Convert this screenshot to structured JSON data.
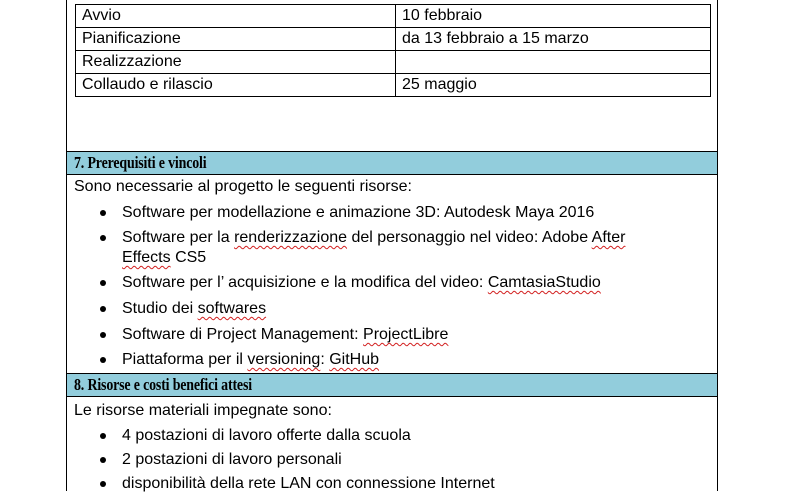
{
  "phases": [
    {
      "name": "Avvio",
      "date": "10 febbraio"
    },
    {
      "name": "Pianificazione",
      "date": "da 13 febbraio a 15 marzo"
    },
    {
      "name": "Realizzazione",
      "date": ""
    },
    {
      "name": "Collaudo e rilascio",
      "date": "25 maggio"
    }
  ],
  "section7": {
    "title": "7. Prerequisiti e vincoli",
    "intro": "Sono necessarie al progetto le seguenti risorse:",
    "items": [
      {
        "a": "Software per modellazione e animazione 3D: Autodesk Maya 2016"
      },
      {
        "a": "Software per la ",
        "b": "renderizzazione",
        "c": " del personaggio nel video: Adobe ",
        "d": "After",
        "e": "Effects",
        "f": " CS5"
      },
      {
        "a": "Software per l’ acquisizione e la modifica del video: ",
        "b": "CamtasiaStudio"
      },
      {
        "a": "Studio dei ",
        "b": "softwares"
      },
      {
        "a": "Software di Project Management: ",
        "b": "ProjectLibre"
      },
      {
        "a": "Piattaforma per il ",
        "b": "versioning",
        "c": ": ",
        "d": "GitHub"
      }
    ]
  },
  "section8": {
    "title": "8. Risorse e costi benefici attesi",
    "intro": "Le risorse materiali impegnate sono:",
    "items": [
      "4 postazioni di lavoro  offerte dalla scuola",
      "2 postazioni di lavoro personali",
      "disponibilità della rete LAN con connessione Internet"
    ]
  },
  "colors": {
    "header_bg": "#92cddc",
    "spellcheck": "#d21f1f"
  }
}
